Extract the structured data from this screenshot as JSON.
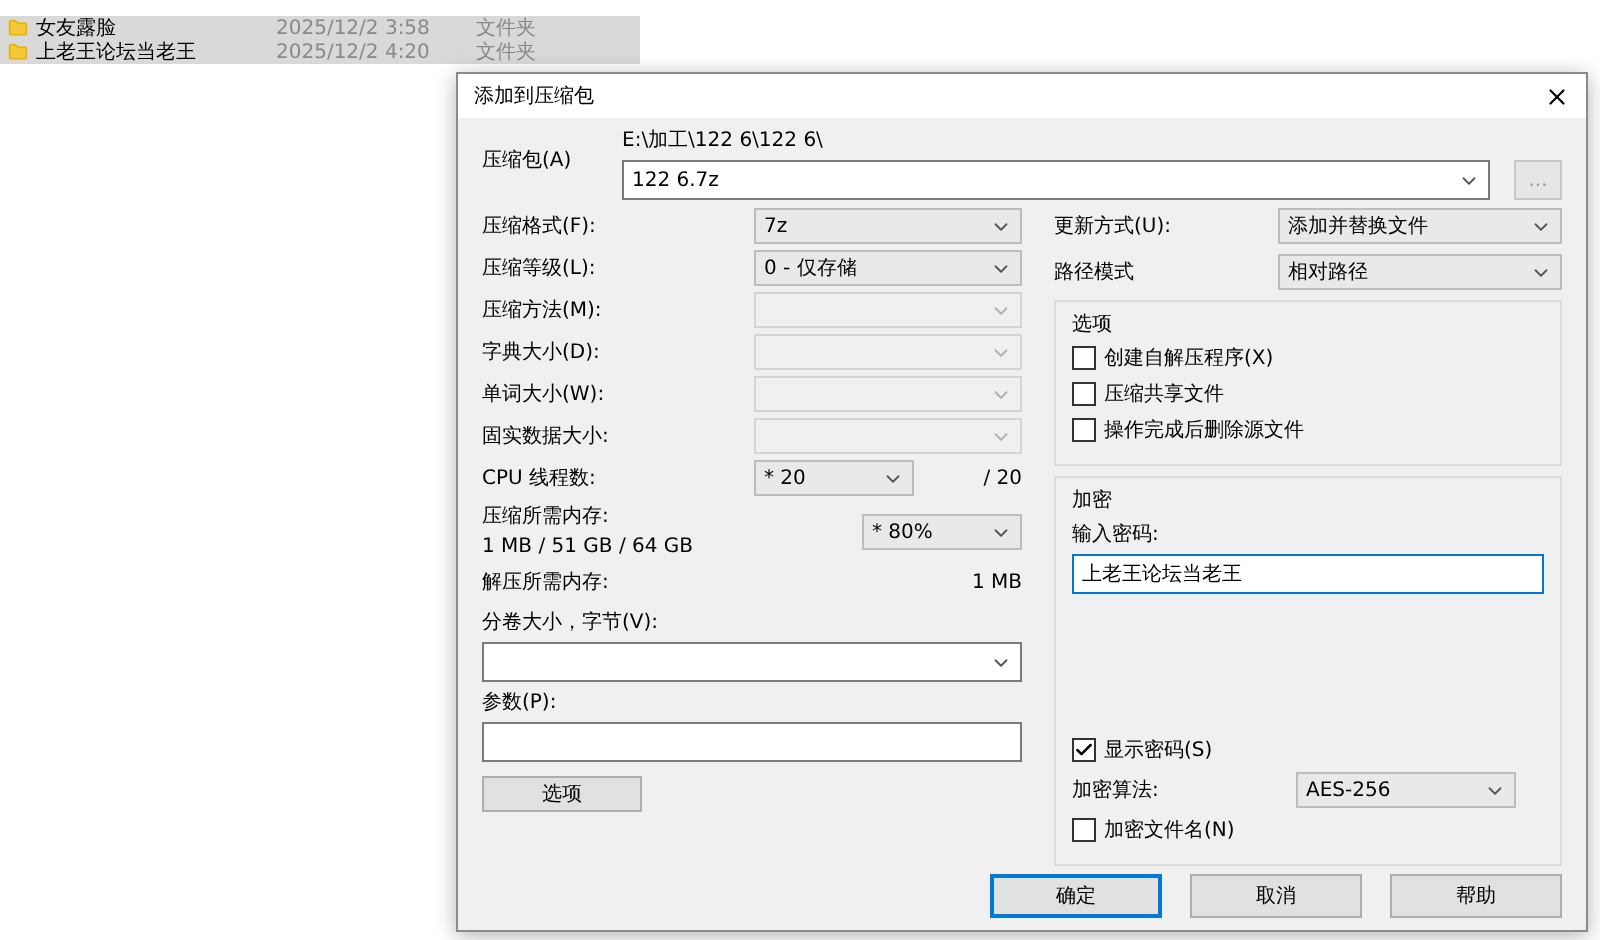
{
  "file_list": {
    "rows": [
      {
        "name": "女友露脸",
        "date": "2025/12/2 3:58",
        "type": "文件夹",
        "selected": true
      },
      {
        "name": "上老王论坛当老王",
        "date": "2025/12/2 4:20",
        "type": "文件夹",
        "selected": true
      }
    ]
  },
  "dialog": {
    "title": "添加到压缩包",
    "archive": {
      "label": "压缩包(A)",
      "path": "E:\\加工\\122 6\\122 6\\",
      "value": "122 6.7z",
      "browse": "..."
    },
    "left_fields": [
      {
        "kind": "select",
        "label": "压缩格式(F):",
        "value": "7z",
        "disabled": false
      },
      {
        "kind": "select",
        "label": "压缩等级(L):",
        "value": "0 - 仅存储",
        "disabled": false
      },
      {
        "kind": "select",
        "label": "压缩方法(M):",
        "disabled": true
      },
      {
        "kind": "select",
        "label": "字典大小(D):",
        "disabled": true
      },
      {
        "kind": "select",
        "label": "单词大小(W):",
        "disabled": true
      },
      {
        "kind": "select",
        "label": "固实数据大小:",
        "disabled": true
      },
      {
        "kind": "threads",
        "label": "CPU 线程数:",
        "value": "* 20",
        "suffix": "/ 20",
        "disabled": false
      },
      {
        "kind": "memory",
        "label": "压缩所需内存:",
        "detail": "1 MB / 51 GB / 64 GB",
        "value": "* 80%",
        "disabled": false
      },
      {
        "kind": "info",
        "label": "解压所需内存:",
        "value": "1 MB"
      }
    ],
    "volume": {
      "label": "分卷大小，字节(V):"
    },
    "params": {
      "label": "参数(P):"
    },
    "options_button": "选项",
    "right_fields": [
      {
        "label": "更新方式(U):",
        "value": "添加并替换文件"
      },
      {
        "label": "路径模式",
        "value": "相对路径"
      }
    ],
    "options_group": {
      "title": "选项",
      "items": [
        {
          "label": "创建自解压程序(X)",
          "checked": false
        },
        {
          "label": "压缩共享文件",
          "checked": false
        },
        {
          "label": "操作完成后删除源文件",
          "checked": false
        }
      ]
    },
    "encryption": {
      "title": "加密",
      "password_label": "输入密码:",
      "password": "上老王论坛当老王",
      "show_password": {
        "label": "显示密码(S)",
        "checked": true
      },
      "method_label": "加密算法:",
      "method": "AES-256",
      "encrypt_names": {
        "label": "加密文件名(N)",
        "checked": false
      }
    },
    "buttons": [
      {
        "label": "确定",
        "default": true
      },
      {
        "label": "取消",
        "default": false
      },
      {
        "label": "帮助",
        "default": false
      }
    ]
  }
}
